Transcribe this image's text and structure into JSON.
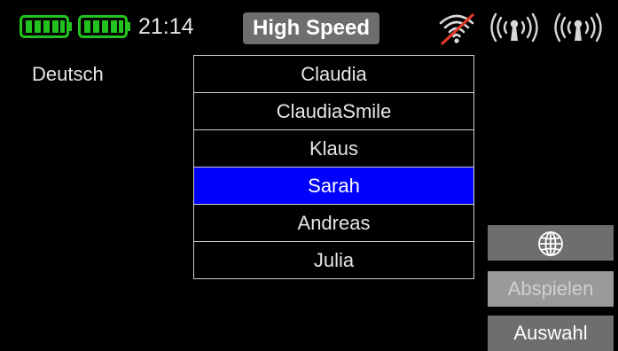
{
  "status_bar": {
    "battery_1": {
      "level": 1.0,
      "color": "#22c31e"
    },
    "battery_2": {
      "level": 1.0,
      "color": "#22c31e"
    },
    "time": "21:14",
    "mode": "High Speed",
    "icons": [
      "wifi-off-icon",
      "antenna-signal-icon",
      "antenna-signal-icon"
    ]
  },
  "language": {
    "label": "Deutsch"
  },
  "voice_list": {
    "items": [
      "Claudia",
      "ClaudiaSmile",
      "Klaus",
      "Sarah",
      "Andreas",
      "Julia"
    ],
    "selected_index": 3
  },
  "side_buttons": {
    "language_button_icon": "globe-icon",
    "play_label": "Abspielen",
    "select_label": "Auswahl"
  },
  "colors": {
    "background": "#000000",
    "selection": "#0000ff",
    "battery": "#22c31e",
    "button": "#6e6e6e",
    "button_disabled": "#9a9a9a",
    "wifi_off_slash": "#e03a2c"
  }
}
